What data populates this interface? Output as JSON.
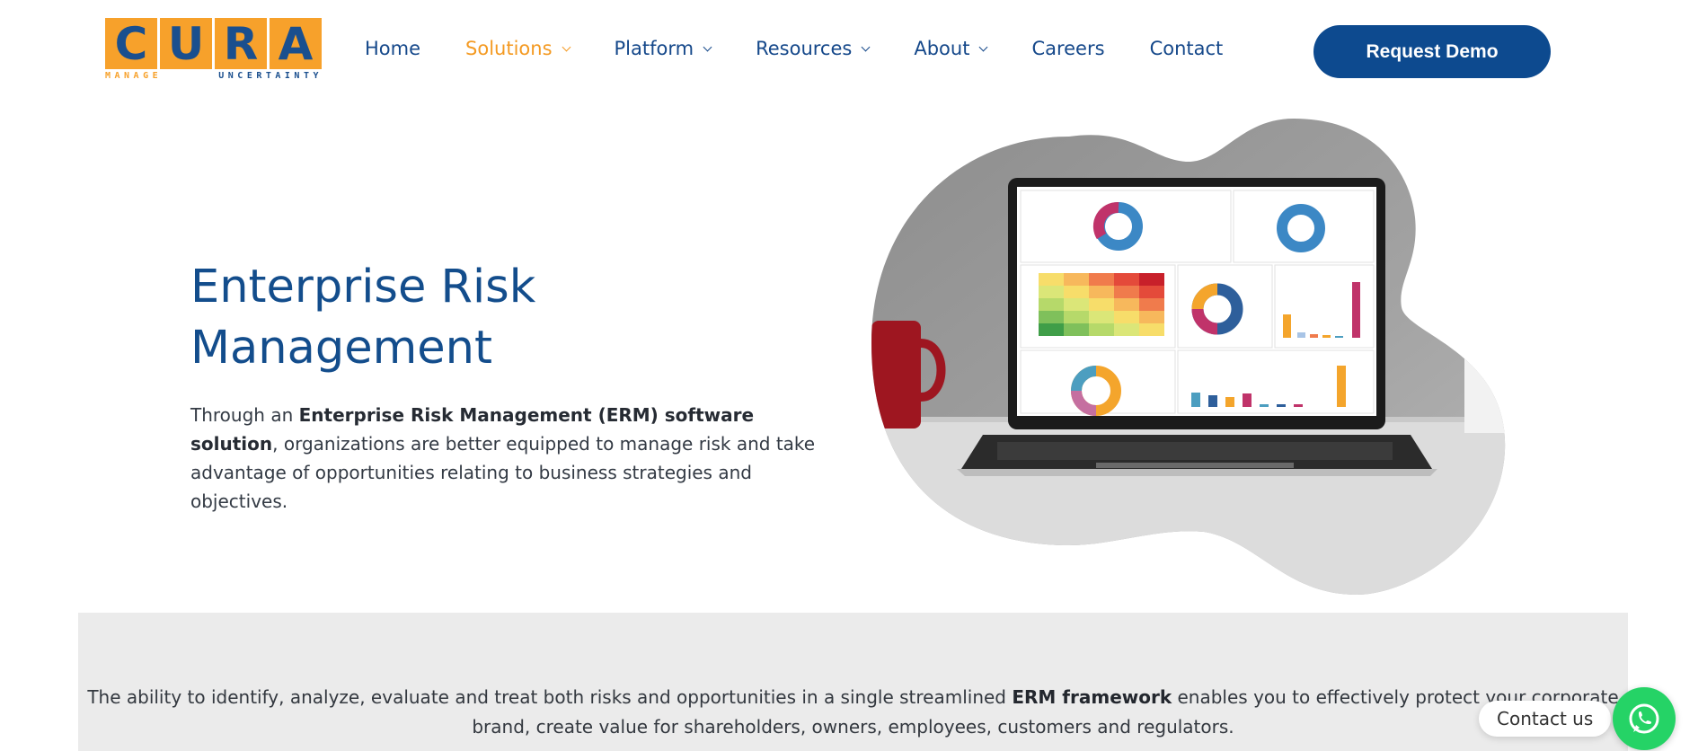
{
  "logo": {
    "letters": [
      "C",
      "U",
      "R",
      "A"
    ],
    "tagline_part1": "MANAGE",
    "tagline_part2": "UNCERTAINTY"
  },
  "nav": {
    "items": [
      {
        "label": "Home",
        "has_dropdown": false,
        "active": false
      },
      {
        "label": "Solutions",
        "has_dropdown": true,
        "active": true
      },
      {
        "label": "Platform",
        "has_dropdown": true,
        "active": false
      },
      {
        "label": "Resources",
        "has_dropdown": true,
        "active": false
      },
      {
        "label": "About",
        "has_dropdown": true,
        "active": false
      },
      {
        "label": "Careers",
        "has_dropdown": false,
        "active": false
      },
      {
        "label": "Contact",
        "has_dropdown": false,
        "active": false
      }
    ],
    "cta_label": "Request Demo"
  },
  "hero": {
    "title_line1": "Enterprise Risk",
    "title_line2": "Management",
    "desc_prefix": "Through an ",
    "desc_bold": "Enterprise Risk Management (ERM) software solution",
    "desc_suffix": ", organizations are better equipped to manage risk and take advantage of opportunities relating to business strategies and objectives."
  },
  "band": {
    "text_prefix": "The ability to identify, analyze, evaluate and treat both risks and opportunities in a single streamlined ",
    "text_bold": "ERM framework",
    "text_suffix": " enables you to effectively protect your corporate brand, create value for shareholders, owners, employees, customers and regulators."
  },
  "contact_widget": {
    "label": "Contact us",
    "icon": "whatsapp-icon"
  },
  "colors": {
    "brand_blue": "#134d8c",
    "brand_orange": "#f7a12b",
    "cta_blue": "#0d4a8f",
    "band_gray": "#ebebeb",
    "whatsapp_green": "#25d366"
  }
}
